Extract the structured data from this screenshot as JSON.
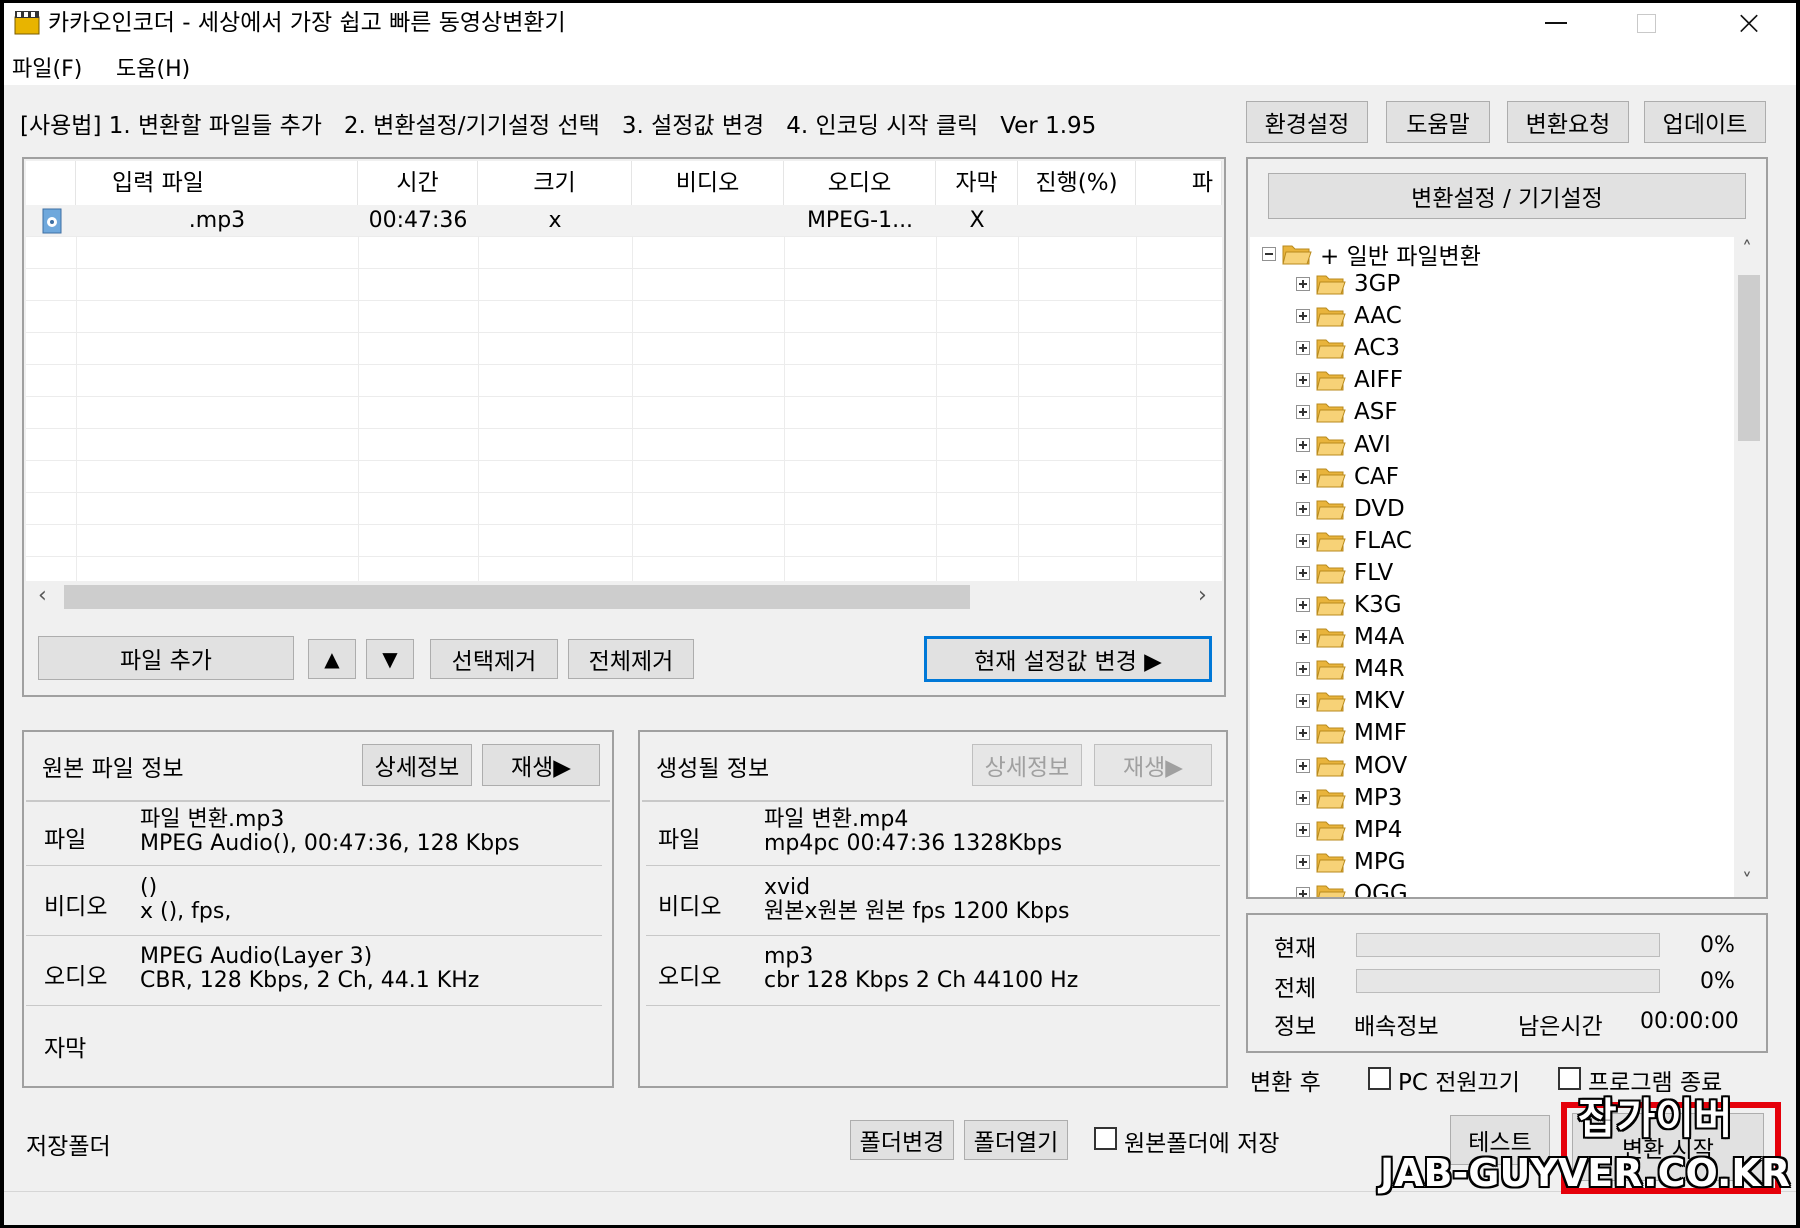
{
  "window": {
    "title": "카카오인코더 - 세상에서 가장 쉽고 빠른 동영상변환기",
    "minimize": "minimize",
    "maximize": "maximize",
    "close": "×"
  },
  "menu": [
    "파일(F)",
    "도움(H)"
  ],
  "usage": [
    "[사용법] 1. 변환할 파일들 추가",
    "2. 변환설정/기기설정 선택",
    "3. 설정값 변경",
    "4. 인코딩 시작 클릭"
  ],
  "version": "Ver 1.95",
  "top_buttons": [
    "환경설정",
    "도움말",
    "변환요청",
    "업데이트"
  ],
  "file_list": {
    "columns": [
      "입력 파일",
      "시간",
      "크기",
      "비디오",
      "오디오",
      "자막",
      "진행(%)",
      "파"
    ],
    "rows": [
      {
        "file": ".mp3",
        "time": "00:47:36",
        "size": "x",
        "video": "",
        "audio": "MPEG-1...",
        "subtitle": "X",
        "progress": ""
      }
    ]
  },
  "list_buttons": {
    "add": "파일 추가",
    "up": "▲",
    "down": "▼",
    "remove_selected": "선택제거",
    "remove_all": "전체제거",
    "apply": "현재 설정값 변경 ▶"
  },
  "source_info": {
    "title": "원본 파일 정보",
    "detail_btn": "상세정보",
    "play_btn": "재생▶",
    "labels": [
      "파일",
      "비디오",
      "오디오",
      "자막"
    ],
    "file": [
      "파일 변환.mp3",
      "MPEG Audio(), 00:47:36, 128 Kbps"
    ],
    "video": [
      "()",
      "x (),  fps,"
    ],
    "audio": [
      "MPEG Audio(Layer 3)",
      "CBR, 128 Kbps, 2 Ch, 44.1 KHz"
    ]
  },
  "output_info": {
    "title": "생성될 정보",
    "detail_btn": "상세정보",
    "play_btn": "재생▶",
    "labels": [
      "파일",
      "비디오",
      "오디오"
    ],
    "file": [
      "파일 변환.mp4",
      "mp4pc   00:47:36   1328Kbps"
    ],
    "video": [
      "xvid",
      "원본x원본   원본 fps   1200 Kbps"
    ],
    "audio": [
      "mp3",
      "cbr     128 Kbps   2 Ch   44100 Hz"
    ]
  },
  "settings": {
    "header_btn": "변환설정 / 기기설정",
    "root": "+ 일반 파일변환",
    "items": [
      "3GP",
      "AAC",
      "AC3",
      "AIFF",
      "ASF",
      "AVI",
      "CAF",
      "DVD",
      "FLAC",
      "FLV",
      "K3G",
      "M4A",
      "M4R",
      "MKV",
      "MMF",
      "MOV",
      "MP3",
      "MP4",
      "MPG",
      "OGG"
    ]
  },
  "progress": {
    "current_label": "현재",
    "current_pct": "0%",
    "total_label": "전체",
    "total_pct": "0%",
    "info_label": "정보",
    "speed_label": "배속정보",
    "remaining_label": "남은시간",
    "remaining": "00:00:00",
    "current_value": 0,
    "total_value": 0
  },
  "after": {
    "label": "변환 후",
    "pc_off": "PC 전원끄기",
    "exit": "프로그램 종료"
  },
  "save": {
    "label": "저장폴더",
    "change": "폴더변경",
    "open": "폴더열기",
    "save_original": "원본폴더에 저장"
  },
  "actions": {
    "test": "테스트",
    "start": "변환 시작"
  },
  "watermark": {
    "line1": "잡가이버",
    "line2": "JAB-GUYVER.CO.KR"
  },
  "colors": {
    "accent": "#0078d7",
    "watermark_red": "#e5000a",
    "folder": "#f5c242"
  }
}
